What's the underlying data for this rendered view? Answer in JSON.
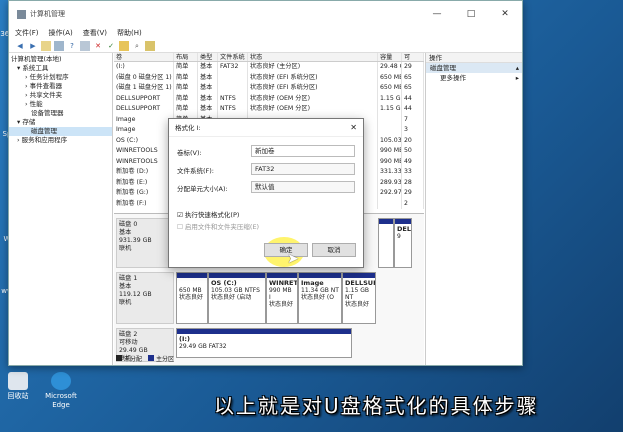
{
  "desktop": {
    "icons": [
      {
        "label": "回收站"
      },
      {
        "label": "Microsoft Edge"
      }
    ],
    "side_labels": [
      "360",
      "Sp",
      "W",
      "ww"
    ]
  },
  "window": {
    "title": "计算机管理",
    "menu": [
      "文件(F)",
      "操作(A)",
      "查看(V)",
      "帮助(H)"
    ],
    "controls": [
      "—",
      "□",
      "✕"
    ]
  },
  "tree": {
    "items": [
      "计算机管理(本地)",
      "系统工具",
      "任务计划程序",
      "事件查看器",
      "共享文件夹",
      "性能",
      "设备管理器",
      "存储",
      "磁盘管理",
      "服务和应用程序"
    ]
  },
  "volumes": {
    "headers": [
      "卷",
      "布局",
      "类型",
      "文件系统",
      "状态",
      "容量",
      "可"
    ],
    "rows": [
      [
        "(I:)",
        "简单",
        "基本",
        "FAT32",
        "状态良好 (主分区)",
        "29.48 GB",
        "29"
      ],
      [
        "(磁盘 0 磁盘分区 1)",
        "简单",
        "基本",
        "",
        "状态良好 (EFI 系统分区)",
        "650 MB",
        "65"
      ],
      [
        "(磁盘 1 磁盘分区 1)",
        "简单",
        "基本",
        "",
        "状态良好 (EFI 系统分区)",
        "650 MB",
        "65"
      ],
      [
        "DELLSUPPORT",
        "简单",
        "基本",
        "NTFS",
        "状态良好 (OEM 分区)",
        "1.15 GB",
        "44"
      ],
      [
        "DELLSUPPORT",
        "简单",
        "基本",
        "NTFS",
        "状态良好 (OEM 分区)",
        "1.15 GB",
        "44"
      ],
      [
        "Image",
        "简单",
        "基本",
        "",
        "",
        "",
        "7"
      ],
      [
        "Image",
        "",
        "",
        "",
        "",
        "",
        "3"
      ],
      [
        "OS (C:)",
        "",
        "",
        "",
        "",
        "105.03 GB",
        "20"
      ],
      [
        "WINRETOOLS",
        "",
        "",
        "",
        "",
        "990 MB",
        "50"
      ],
      [
        "WINRETOOLS",
        "",
        "",
        "",
        "",
        "990 MB",
        "49"
      ],
      [
        "新加卷 (D:)",
        "",
        "",
        "",
        "",
        "331.33 GB",
        "33"
      ],
      [
        "新加卷 (E:)",
        "",
        "",
        "",
        "",
        "289.93 GB",
        "28"
      ],
      [
        "新加卷 (G:)",
        "",
        "",
        "",
        "",
        "292.97 GB",
        "29"
      ],
      [
        "新加卷 (F:)",
        "",
        "",
        "",
        "",
        "",
        "2"
      ]
    ]
  },
  "disks": [
    {
      "name": "磁盘 0",
      "type": "基本",
      "size": "931.39 GB",
      "status": "联机",
      "parts": [
        {
          "name": "DELI",
          "line": "9"
        }
      ]
    },
    {
      "name": "磁盘 1",
      "type": "基本",
      "size": "119.12 GB",
      "status": "联机",
      "parts": [
        {
          "name": "",
          "size": "650 MB",
          "status": "状态良好"
        },
        {
          "name": "OS (C:)",
          "size": "105.03 GB NTFS",
          "status": "状态良好 (启动"
        },
        {
          "name": "WINRET",
          "size": "990 MB I",
          "status": "状态良好"
        },
        {
          "name": "Image",
          "size": "11.34 GB NT",
          "status": "状态良好 (O"
        },
        {
          "name": "DELLSUF",
          "size": "1.15 GB NT",
          "status": "状态良好"
        }
      ]
    },
    {
      "name": "磁盘 2",
      "type": "可移动",
      "size": "29.49 GB",
      "status": "联机",
      "parts": [
        {
          "name": "(I:)",
          "size": "29.49 GB FAT32",
          "status": ""
        }
      ]
    }
  ],
  "legend": [
    "未分配",
    "主分区"
  ],
  "ops": {
    "header": "操作",
    "section": "磁盘管理",
    "item": "更多操作"
  },
  "dialog": {
    "title": "格式化 I:",
    "close": "✕",
    "label_volume": "卷标(V):",
    "value_volume": "新加卷",
    "label_fs": "文件系统(F):",
    "value_fs": "FAT32",
    "label_alloc": "分配单元大小(A):",
    "value_alloc": "默认值",
    "quick": "执行快速格式化(P)",
    "compress": "启用文件和文件夹压缩(E)",
    "ok": "确定",
    "cancel": "取消"
  },
  "caption": "以上就是对U盘格式化的具体步骤",
  "colors": {
    "primary_partition": "#1d2f8c",
    "unallocated": "#222222",
    "accent": "#ffef3c"
  }
}
